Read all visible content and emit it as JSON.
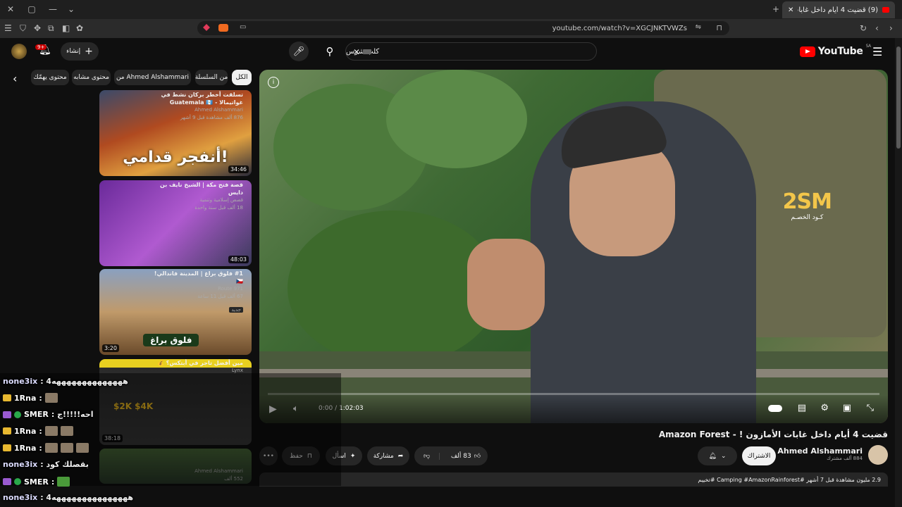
{
  "browser": {
    "tab_title": "(9) قضيت 4 أيام داخل غابات الأمازون",
    "url": "youtube.com/watch?v=XGCJNKTVWZs",
    "icons": [
      "close-icon",
      "restore-icon",
      "minimize-icon",
      "chevron-down-icon",
      "menu-icon",
      "shield-icon",
      "extensions-icon",
      "tabs-icon",
      "sidebar-icon",
      "puzzle-icon",
      "reload-icon",
      "back-icon",
      "forward-icon",
      "bookmark-icon"
    ]
  },
  "youtube": {
    "logo_text": "YouTube",
    "logo_region": "SA",
    "search_value": "كلب شرس",
    "create_label": "إنشاء",
    "notification_count": "9+"
  },
  "chips": {
    "all": "الكل",
    "series": "من السلسلة",
    "channel": "من Ahmed Alshammari",
    "related": "محتوى مشابه",
    "more": "محتوى يهمّك"
  },
  "player": {
    "channel_logo": "2SM",
    "channel_logo_sub": "كـود الخصـم",
    "time": "0:00 / 1:02:03"
  },
  "video": {
    "title": "قضيت 4 أيام داخل غابات الأمازون ! - Amazon Forest",
    "channel": "Ahmed Alshammari",
    "subscribers": "884 ألف مشترك",
    "subscribe_label": "الاشتراك",
    "likes": "83 ألف",
    "share_label": "مشاركة",
    "ask_label": "اسأل",
    "save_label": "حفظ",
    "description": "2.9 مليون مشاهدة  قبل 7 أشهر  #Camping #AmazonRainforest #تخييم"
  },
  "sidebar": [
    {
      "title": "تسلقت أخطر بركان نشط في غواتيمالا - Guatemala 🇬🇹",
      "channel": "Ahmed Alshammari",
      "meta": "876 ألف  مشاهدة  قبل 9 أشهر",
      "duration": "34:46",
      "overlay": "أنفجر قدامي!"
    },
    {
      "title": "قصة فتح مكة | الشيخ نايف بن دايس",
      "channel": "قصص إسلامية وتنمية",
      "meta": "18 ألف  قبل سنة واحدة",
      "duration": "48:03",
      "overlay": ""
    },
    {
      "title": "#1 فلوق براغ | المدينة فاندالي! 🇨🇿",
      "channel": "Route 971",
      "meta": "67 ألف  قبل 11 ساعة",
      "badge": "جديد",
      "duration": "3:20",
      "overlay": "فلوق براغ"
    },
    {
      "title": "مين أفضل تاجر في أبتكس؟ 💰",
      "channel": "Lynx",
      "meta": "",
      "duration": "38:18",
      "overlay": "$2K  $4K"
    },
    {
      "title": "",
      "channel": "Ahmed Alshammari",
      "meta": "552 ألف",
      "duration": "",
      "overlay": ""
    }
  ],
  "chat": [
    {
      "user": "none3ix",
      "text": ": 4ههههههههههههههه"
    },
    {
      "user": "1Rna",
      "text": ":"
    },
    {
      "user": "SMER",
      "text": ": احه!!!!!ج"
    },
    {
      "user": "1Rna",
      "text": ":"
    },
    {
      "user": "1Rna",
      "text": ":"
    },
    {
      "user": "none3ix",
      "text": ": بقصلك كود"
    },
    {
      "user": "SMER",
      "text": ":"
    },
    {
      "user": "none3ix",
      "text": ": 4هههههههههههههههه"
    }
  ],
  "colors": {
    "accent": "#ff0000",
    "chip_selected": "#f1f1f1",
    "surface": "#272727",
    "background": "#0f0f0f",
    "chat_user": "#e8e8ff",
    "logo_gold": "#f3c64a"
  }
}
